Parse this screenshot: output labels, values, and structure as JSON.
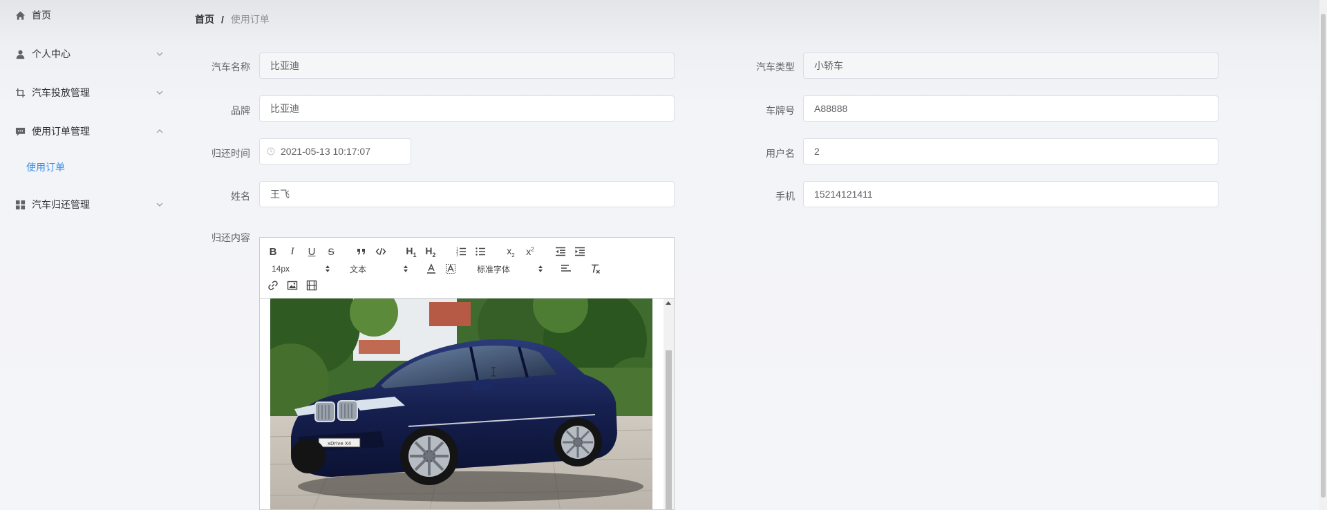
{
  "sidebar": {
    "items": [
      {
        "label": "首页",
        "icon": "home-icon"
      },
      {
        "label": "个人中心",
        "icon": "user-icon"
      },
      {
        "label": "汽车投放管理",
        "icon": "crop-icon"
      },
      {
        "label": "使用订单管理",
        "icon": "message-icon"
      },
      {
        "label": "使用订单",
        "icon": ""
      },
      {
        "label": "汽车归还管理",
        "icon": "grid-icon"
      }
    ]
  },
  "breadcrumb": {
    "home": "首页",
    "separator": "/",
    "current": "使用订单"
  },
  "form": {
    "car_name_label": "汽车名称",
    "car_name_value": "比亚迪",
    "car_type_label": "汽车类型",
    "car_type_value": "小轿车",
    "brand_label": "品牌",
    "brand_value": "比亚迪",
    "plate_label": "车牌号",
    "plate_value": "A88888",
    "return_time_label": "归还时间",
    "return_time_value": "2021-05-13 10:17:07",
    "username_label": "用户名",
    "username_value": "2",
    "name_label": "姓名",
    "name_value": "王飞",
    "phone_label": "手机",
    "phone_value": "15214121411",
    "content_label": "归还内容"
  },
  "editor": {
    "font_size": "14px",
    "heading": "文本",
    "font_family": "标准字体",
    "image_caption": "xDrive X4"
  },
  "colors": {
    "accent": "#3a8ee6",
    "car_body": "#16204f"
  }
}
